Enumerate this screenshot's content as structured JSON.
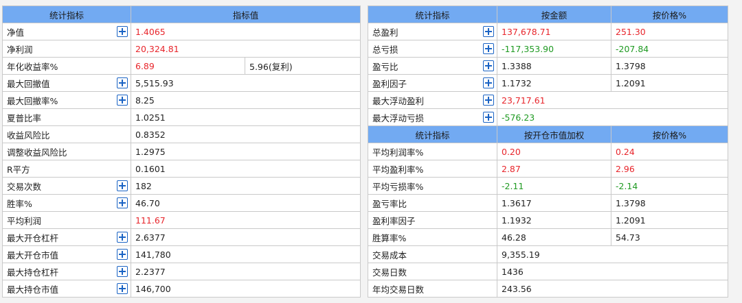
{
  "left": {
    "headers": [
      "统计指标",
      "指标值"
    ],
    "rows": [
      {
        "label": "净值",
        "value": "1.4065",
        "color": "red",
        "expand": true
      },
      {
        "label": "净利润",
        "value": "20,324.81",
        "color": "red",
        "expand": false
      },
      {
        "label": "年化收益率%",
        "value": "6.89",
        "extra": "5.96(复利)",
        "color": "red",
        "expand": false
      },
      {
        "label": "最大回撤值",
        "value": "5,515.93",
        "color": "",
        "expand": true
      },
      {
        "label": "最大回撤率%",
        "value": "8.25",
        "color": "",
        "expand": true
      },
      {
        "label": "夏普比率",
        "value": "1.0251",
        "color": "",
        "expand": false
      },
      {
        "label": "收益风险比",
        "value": "0.8352",
        "color": "",
        "expand": false
      },
      {
        "label": "调整收益风险比",
        "value": "1.2975",
        "color": "",
        "expand": false
      },
      {
        "label": "R平方",
        "value": "0.1601",
        "color": "",
        "expand": false
      },
      {
        "label": "交易次数",
        "value": "182",
        "color": "",
        "expand": true
      },
      {
        "label": "胜率%",
        "value": "46.70",
        "color": "",
        "expand": true
      },
      {
        "label": "平均利润",
        "value": "111.67",
        "color": "red",
        "expand": false
      },
      {
        "label": "最大开仓杠杆",
        "value": "2.6377",
        "color": "",
        "expand": true
      },
      {
        "label": "最大开仓市值",
        "value": "141,780",
        "color": "",
        "expand": true
      },
      {
        "label": "最大持仓杠杆",
        "value": "2.2377",
        "color": "",
        "expand": true
      },
      {
        "label": "最大持仓市值",
        "value": "146,700",
        "color": "",
        "expand": true
      }
    ]
  },
  "right_top": {
    "headers": [
      "统计指标",
      "按金额",
      "按价格%"
    ],
    "rows": [
      {
        "label": "总盈利",
        "v1": "137,678.71",
        "v2": "251.30",
        "c1": "red",
        "c2": "red",
        "expand": true
      },
      {
        "label": "总亏损",
        "v1": "-117,353.90",
        "v2": "-207.84",
        "c1": "green",
        "c2": "green",
        "expand": true
      },
      {
        "label": "盈亏比",
        "v1": "1.3388",
        "v2": "1.3798",
        "c1": "",
        "c2": "",
        "expand": true
      },
      {
        "label": "盈利因子",
        "v1": "1.1732",
        "v2": "1.2091",
        "c1": "",
        "c2": "",
        "expand": true
      },
      {
        "label": "最大浮动盈利",
        "v1": "23,717.61",
        "c1": "red",
        "expand": true
      },
      {
        "label": "最大浮动亏损",
        "v1": "-576.23",
        "c1": "green",
        "expand": true
      }
    ]
  },
  "right_bottom": {
    "headers": [
      "统计指标",
      "按开仓市值加权",
      "按价格%"
    ],
    "rows": [
      {
        "label": "平均利润率%",
        "v1": "0.20",
        "v2": "0.24",
        "c1": "red",
        "c2": "red"
      },
      {
        "label": "平均盈利率%",
        "v1": "2.87",
        "v2": "2.96",
        "c1": "red",
        "c2": "red"
      },
      {
        "label": "平均亏损率%",
        "v1": "-2.11",
        "v2": "-2.14",
        "c1": "green",
        "c2": "green"
      },
      {
        "label": "盈亏率比",
        "v1": "1.3617",
        "v2": "1.3798",
        "c1": "",
        "c2": ""
      },
      {
        "label": "盈利率因子",
        "v1": "1.1932",
        "v2": "1.2091",
        "c1": "",
        "c2": ""
      },
      {
        "label": "胜算率%",
        "v1": "46.28",
        "v2": "54.73",
        "c1": "",
        "c2": ""
      },
      {
        "label": "交易成本",
        "v1": "9,355.19",
        "c1": ""
      },
      {
        "label": "交易日数",
        "v1": "1436",
        "c1": ""
      },
      {
        "label": "年均交易日数",
        "v1": "243.56",
        "c1": ""
      }
    ]
  },
  "colors": {
    "header_bg": "#72aaf2",
    "positive": "#e8252b",
    "negative": "#1f9a22",
    "expand_icon": "#1a63c4"
  }
}
